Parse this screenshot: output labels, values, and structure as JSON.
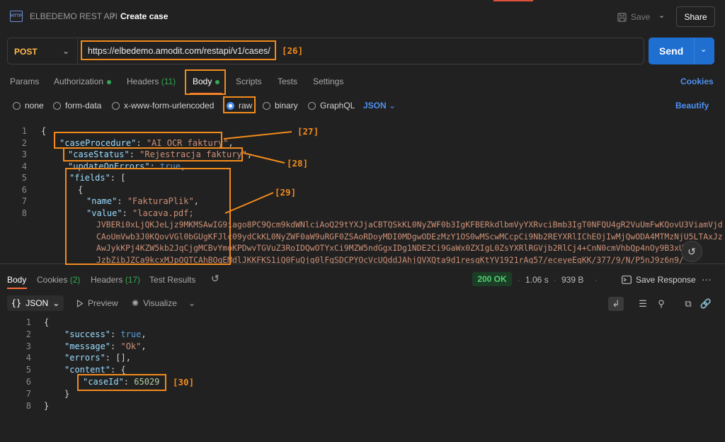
{
  "header": {
    "collection": "ELBEDEMO REST API",
    "separator": "/",
    "title": "Create case",
    "save_label": "Save",
    "share_label": "Share",
    "http_badge": "HTTP"
  },
  "request": {
    "method": "POST",
    "url": "https://elbedemo.amodit.com/restapi/v1/cases/",
    "send_label": "Send"
  },
  "tabs": {
    "params": "Params",
    "authorization": "Authorization",
    "headers": "Headers",
    "headers_count": "(11)",
    "body": "Body",
    "scripts": "Scripts",
    "tests": "Tests",
    "settings": "Settings",
    "cookies": "Cookies"
  },
  "body_types": {
    "none": "none",
    "form_data": "form-data",
    "urlencoded": "x-www-form-urlencoded",
    "raw": "raw",
    "binary": "binary",
    "graphql": "GraphQL",
    "language": "JSON",
    "beautify": "Beautify",
    "selected": "raw"
  },
  "request_body": {
    "line_numbers": [
      "1",
      "2",
      "3",
      "4",
      "5",
      "6",
      "7",
      "8"
    ],
    "open_brace": "{",
    "case_procedure_key": "\"caseProcedure\"",
    "case_procedure_value": "\"AI OCR faktury\"",
    "case_status_key": "\"caseStatus\"",
    "case_status_value": "\"Rejestracja faktury\"",
    "update_on_errors_key": "\"updateOnErrors\"",
    "update_on_errors_value": "true",
    "fields_key": "\"fields\"",
    "fields_open": "[",
    "obj_open": "{",
    "name_key": "\"name\"",
    "name_value": "\"FakturaPlik\"",
    "value_key": "\"value\"",
    "value_start": "\"lacava.pdf;",
    "base64_lines": [
      "JVBERi0xLjQKJeLjz9MKMSAwIG9iago8PC9Qcm9kdWNlciAoQ29tYXJjaCBTQSkKL0NyZWF0b3IgKFBERkdlbmVyYXRvciBmb3IgT0NFQU4gR2VuUmFwKQovU3ViamVjd",
      "CAoUmVwb3J0KQovVGl0bGUgKFJlc09ydCkKL0NyZWF0aW9uRGF0ZSAoRDoyMDI0MDgwODEzMzY1OS0wMScwMCcpCi9Nb2REYXRlIChEOjIwMjQwODA4MTMzNjU5LTAxJz",
      "AwJykKPj4KZW5kb2JqCjgMCBvYmoKPDwvTGVuZ3RoIDQwOTYxCi9MZW5ndGgxIDg1NDE2Ci9GaWx0ZXIgL0ZsYXRlRGVjb2RlCj4+CnN0cmVhbQp4nOy9B3xUV",
      "JzbZibJZCa9kcxMJpOQTCAhBOgEMdlJKKFKS1iQ0FuQjg0lFgSDCPYOcVcUQddJAhjQVXQta9d1resqKtYV1921rAq57/eceyeEgKK/377/9/N/P5nJ9z6n9/"
    ],
    "annotations": [
      "[27]",
      "[28]",
      "[29]"
    ]
  },
  "response": {
    "tabs": {
      "body": "Body",
      "cookies": "Cookies",
      "cookies_count": "(2)",
      "headers": "Headers",
      "headers_count": "(17)",
      "test_results": "Test Results"
    },
    "status": "200 OK",
    "time": "1.06 s",
    "size": "939 B",
    "save_response": "Save Response",
    "format": "JSON",
    "preview": "Preview",
    "visualize": "Visualize",
    "line_numbers": [
      "1",
      "2",
      "3",
      "4",
      "5",
      "6",
      "7",
      "8"
    ],
    "open_brace": "{",
    "success_key": "\"success\"",
    "success_value": "true",
    "message_key": "\"message\"",
    "message_value": "\"Ok\"",
    "errors_key": "\"errors\"",
    "errors_value": "[]",
    "content_key": "\"content\"",
    "content_open": "{",
    "case_id_key": "\"caseId\"",
    "case_id_value": "65029",
    "inner_close": "}",
    "close_brace": "}",
    "annotation": "[30]"
  },
  "url_annotation": "[26]",
  "colors": {
    "accent_orange": "#ff6c37",
    "send_blue": "#1f6fd1",
    "link_blue": "#4d90f0",
    "status_green": "#4fcf6f",
    "annotation_orange": "#f28b1d"
  }
}
